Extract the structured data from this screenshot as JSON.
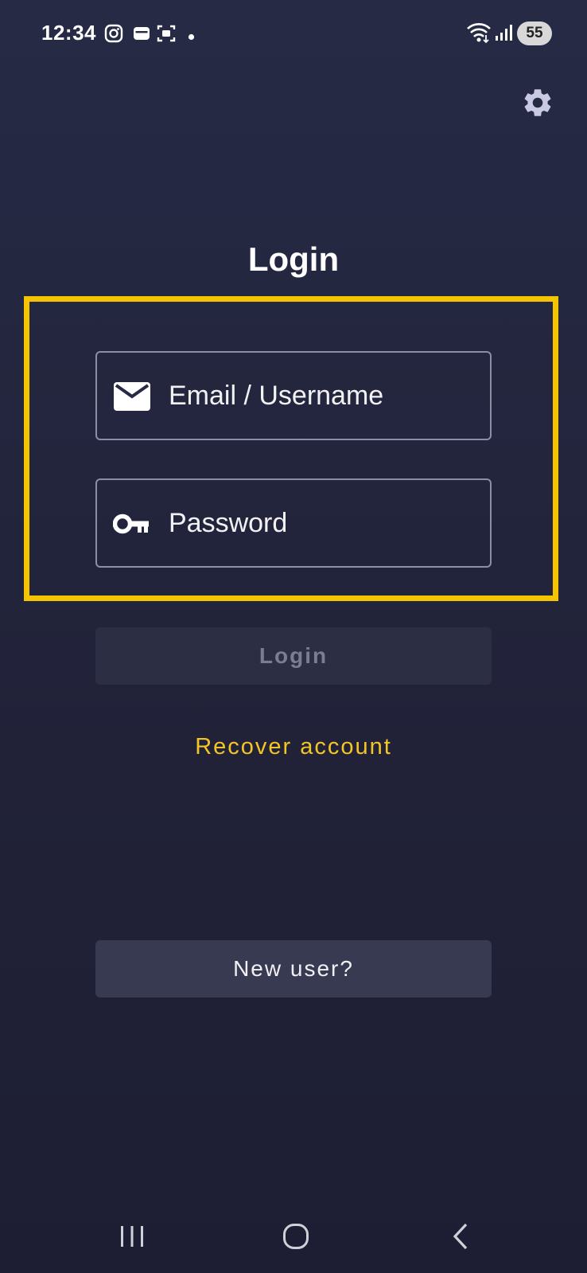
{
  "status_bar": {
    "time": "12:34",
    "notification_icons": [
      "instagram-icon",
      "wallet-icon",
      "screenshot-icon",
      "dot-icon"
    ],
    "battery_level": "55",
    "system_icons": [
      "wifi-icon",
      "signal-icon"
    ]
  },
  "header": {
    "settings_icon": "gear-icon"
  },
  "page": {
    "title": "Login"
  },
  "form": {
    "email_field": {
      "placeholder": "Email / Username",
      "value": "",
      "icon": "mail-icon"
    },
    "password_field": {
      "placeholder": "Password",
      "value": "",
      "icon": "key-icon"
    },
    "highlight_color": "#f5c400"
  },
  "actions": {
    "login_label": "Login",
    "login_enabled": false,
    "recover_label": "Recover account",
    "new_user_label": "New user?"
  },
  "colors": {
    "accent": "#f3c623",
    "background": "#222338",
    "disabled_button": "#2c2e44",
    "secondary_button": "#383a52"
  },
  "nav_bar": {
    "items": [
      "recents-icon",
      "home-icon",
      "back-icon"
    ]
  }
}
